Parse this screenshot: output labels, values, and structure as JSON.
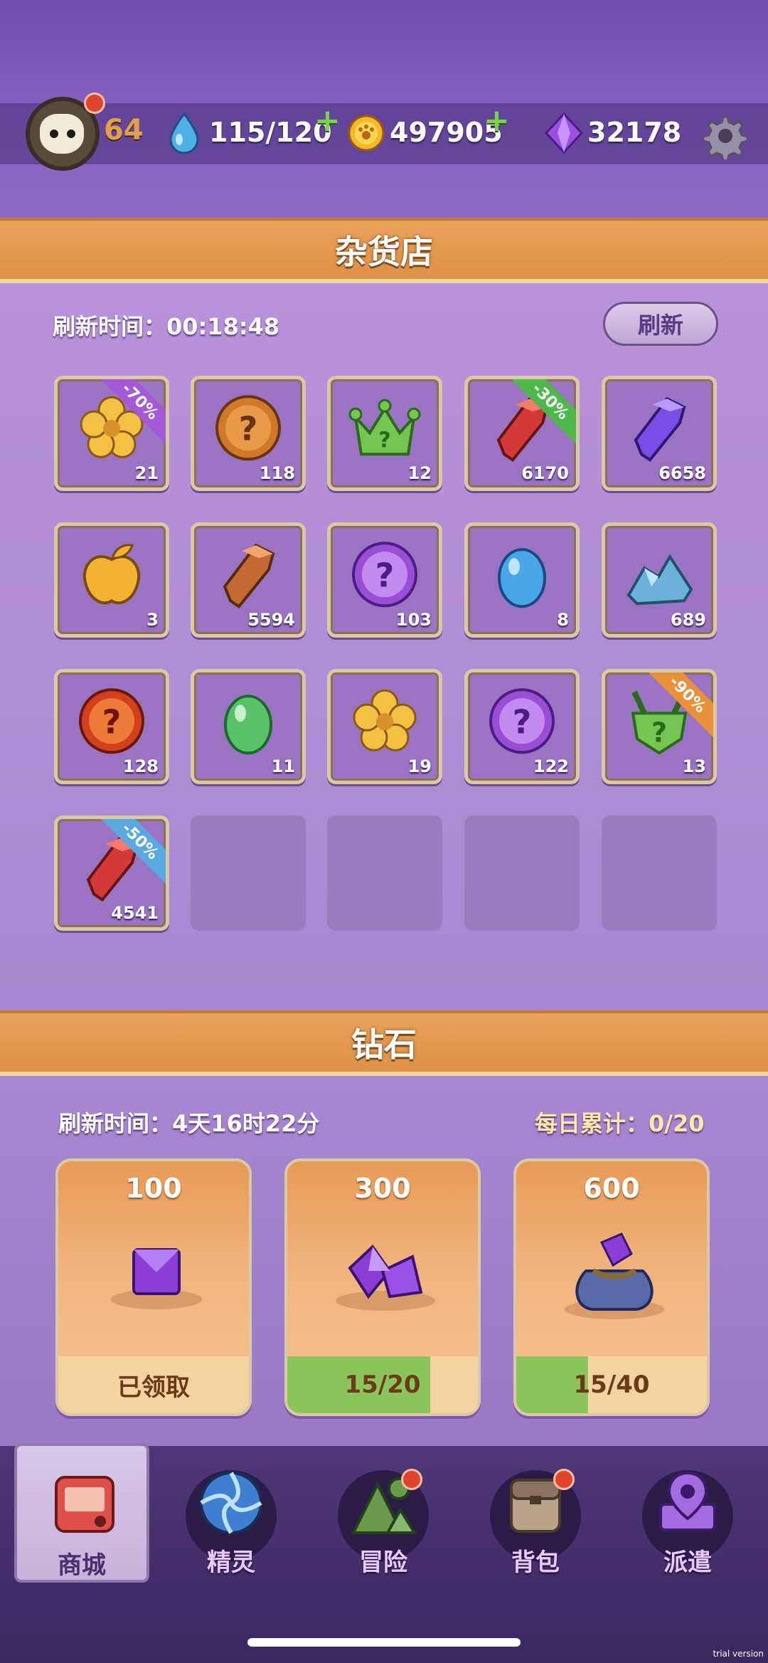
{
  "topbar": {
    "level": "64",
    "energy": "115/120",
    "coins": "497905",
    "gems": "32178"
  },
  "shop": {
    "title": "杂货店",
    "refresh_time_label": "刷新时间：00:18:48",
    "refresh_button": "刷新",
    "items": [
      {
        "icon": "gold-flower-icon",
        "count": "21",
        "discount": "-70%",
        "discount_color": "#a45ad6"
      },
      {
        "icon": "bronze-mystery-orb-icon",
        "count": "118"
      },
      {
        "icon": "green-crown-icon",
        "count": "12"
      },
      {
        "icon": "red-crystal-icon",
        "count": "6170",
        "discount": "-30%",
        "discount_color": "#4fb84a"
      },
      {
        "icon": "purple-crystal-icon",
        "count": "6658"
      },
      {
        "icon": "golden-apple-icon",
        "count": "3"
      },
      {
        "icon": "bronze-crystal-icon",
        "count": "5594"
      },
      {
        "icon": "purple-mystery-orb-icon",
        "count": "103"
      },
      {
        "icon": "blue-egg-icon",
        "count": "8"
      },
      {
        "icon": "blue-ore-icon",
        "count": "689"
      },
      {
        "icon": "red-mystery-orb-icon",
        "count": "128"
      },
      {
        "icon": "green-egg-icon",
        "count": "11"
      },
      {
        "icon": "gold-flower-icon",
        "count": "19"
      },
      {
        "icon": "purple-mystery-orb-icon",
        "count": "122"
      },
      {
        "icon": "green-mystery-helmet-icon",
        "count": "13",
        "discount": "-90%",
        "discount_color": "#e8913a"
      },
      {
        "icon": "red-crystal-icon",
        "count": "4541",
        "discount": "-50%",
        "discount_color": "#5aa8e0"
      }
    ]
  },
  "diamond": {
    "title": "钻石",
    "refresh_time_label": "刷新时间：4天16时22分",
    "daily_label": "每日累计：0/20",
    "cards": [
      {
        "amount": "100",
        "status": "已领取",
        "progress": 0
      },
      {
        "amount": "300",
        "status": "15/20",
        "progress": 0.75
      },
      {
        "amount": "600",
        "status": "15/40",
        "progress": 0.375
      }
    ]
  },
  "nav": {
    "items": [
      {
        "label": "商城",
        "icon": "shop-icon",
        "active": true
      },
      {
        "label": "精灵",
        "icon": "portal-icon",
        "active": false
      },
      {
        "label": "冒险",
        "icon": "mountain-icon",
        "active": false,
        "badge": true
      },
      {
        "label": "背包",
        "icon": "backpack-icon",
        "active": false,
        "badge": true
      },
      {
        "label": "派遣",
        "icon": "map-pin-icon",
        "active": false
      }
    ]
  },
  "watermark": "trial version"
}
